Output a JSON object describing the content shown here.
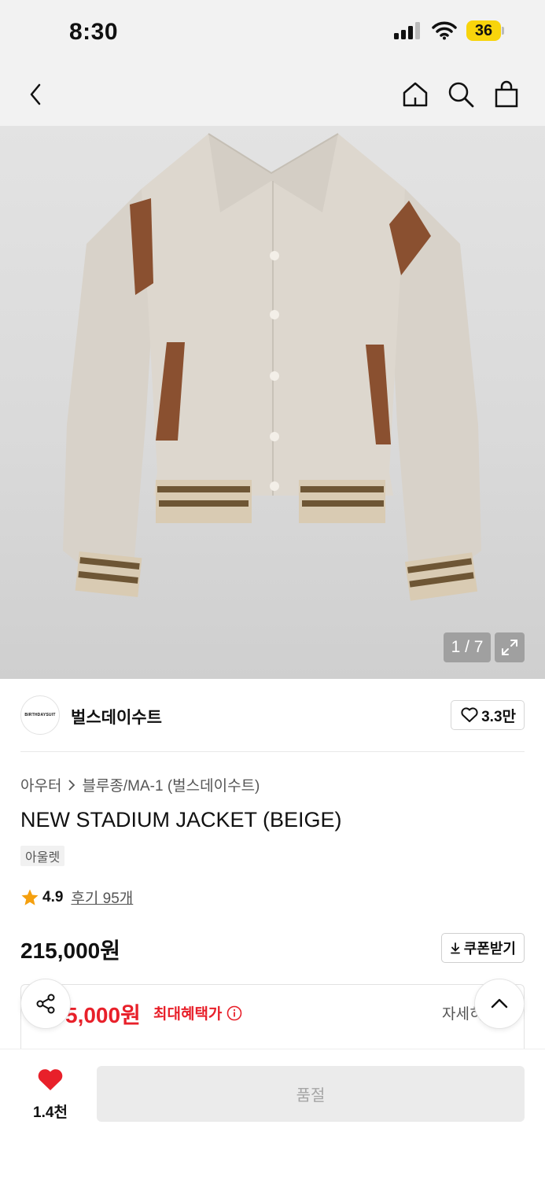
{
  "status_bar": {
    "time": "8:30",
    "battery": "36"
  },
  "nav": {
    "back_icon": "chevron-left-icon",
    "home_icon": "home-icon",
    "search_icon": "search-icon",
    "cart_icon": "shopping-bag-icon"
  },
  "gallery": {
    "counter": "1 / 7"
  },
  "brand": {
    "logo_text": "BIRTHDAYSUIT",
    "name": "벌스데이수트",
    "likes": "3.3만"
  },
  "breadcrumb": {
    "category": "아우터",
    "subcategory": "블루종/MA-1 (벌스데이수트)"
  },
  "product": {
    "title": "NEW STADIUM JACKET (BEIGE)",
    "tag": "아울렛",
    "rating": "4.9",
    "reviews": "후기 95개",
    "price": "215,000원"
  },
  "coupon": {
    "label": "쿠폰받기"
  },
  "benefit": {
    "price": "5,000원",
    "label": "최대혜택가",
    "detail": "자세히"
  },
  "bottom": {
    "likes": "1.4천",
    "soldout": "품절"
  },
  "colors": {
    "accent_red": "#e8202a",
    "battery_yellow": "#f8d40c"
  }
}
